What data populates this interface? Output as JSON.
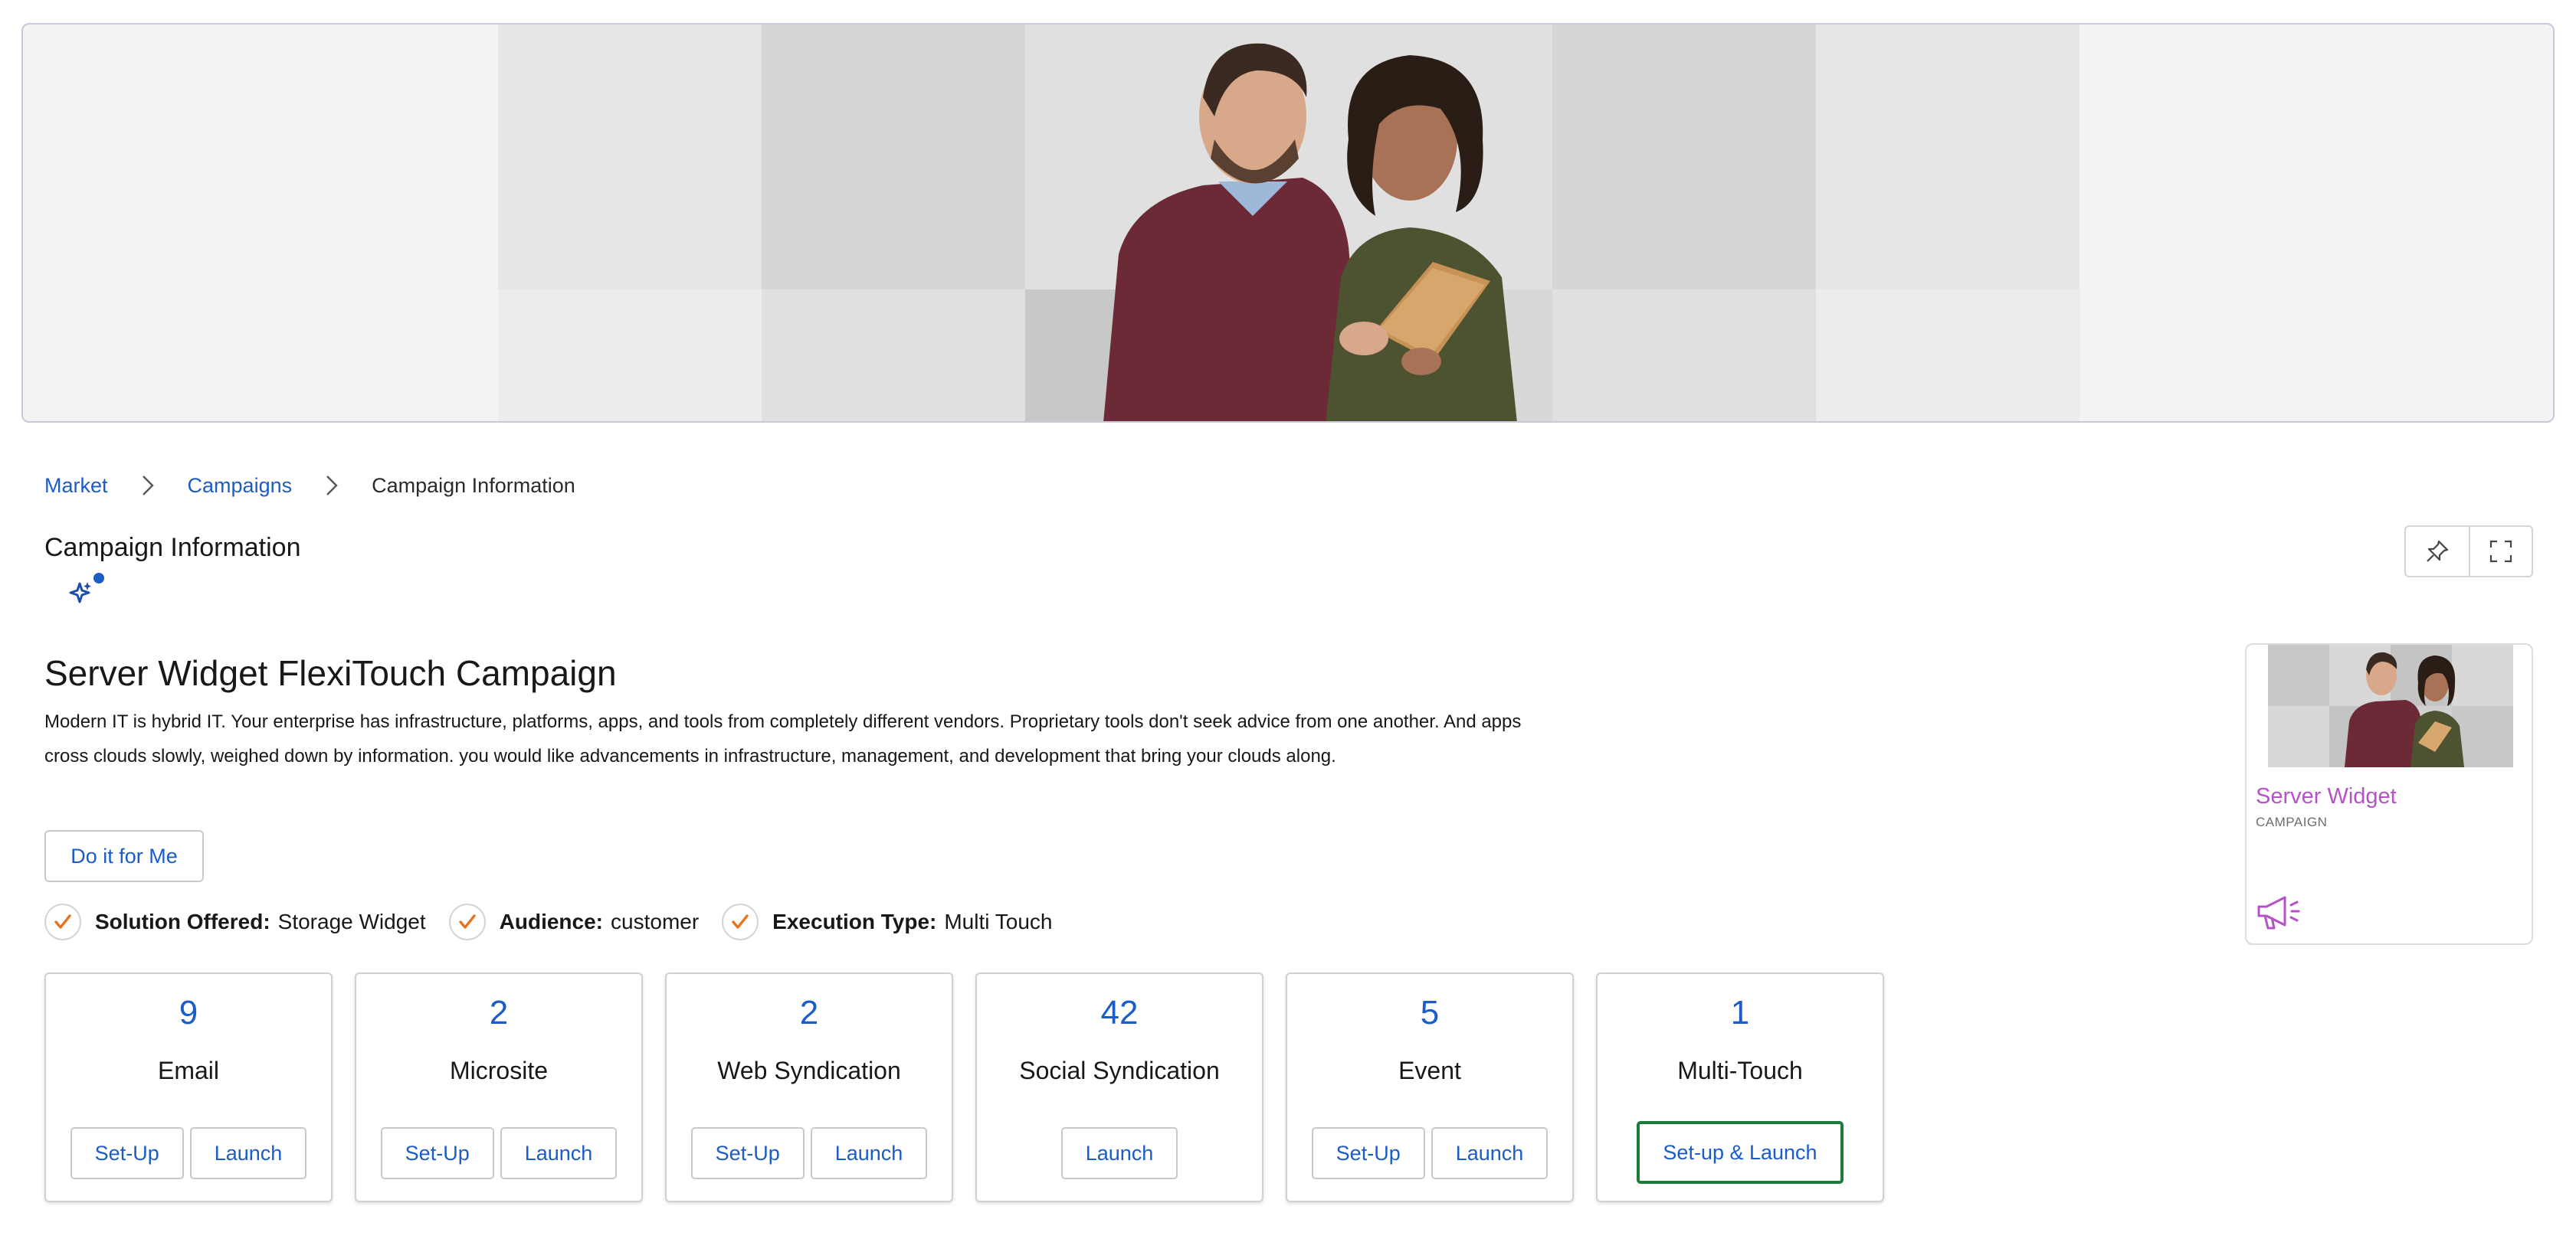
{
  "breadcrumb": {
    "items": [
      {
        "label": "Market"
      },
      {
        "label": "Campaigns"
      }
    ],
    "current": "Campaign Information"
  },
  "page": {
    "title": "Campaign Information"
  },
  "campaign": {
    "name": "Server Widget FlexiTouch Campaign",
    "description": "Modern IT is hybrid IT. Your enterprise has infrastructure, platforms, apps, and tools from completely different vendors. Proprietary tools don't seek advice from one another. And apps cross clouds slowly, weighed down by information. you would like advancements in infrastructure, management, and development that bring your clouds along.",
    "do_it_label": "Do it for Me",
    "attributes": [
      {
        "label": "Solution Offered:",
        "value": "Storage Widget"
      },
      {
        "label": "Audience:",
        "value": "customer"
      },
      {
        "label": "Execution Type:",
        "value": "Multi Touch"
      }
    ]
  },
  "tiles": [
    {
      "count": "9",
      "name": "Email",
      "actions": [
        "Set-Up",
        "Launch"
      ]
    },
    {
      "count": "2",
      "name": "Microsite",
      "actions": [
        "Set-Up",
        "Launch"
      ]
    },
    {
      "count": "2",
      "name": "Web Syndication",
      "actions": [
        "Set-Up",
        "Launch"
      ]
    },
    {
      "count": "42",
      "name": "Social Syndication",
      "actions": [
        "Launch"
      ]
    },
    {
      "count": "5",
      "name": "Event",
      "actions": [
        "Set-Up",
        "Launch"
      ]
    },
    {
      "count": "1",
      "name": "Multi-Touch",
      "actions": [
        "Set-up & Launch"
      ]
    }
  ],
  "side_card": {
    "title": "Server Widget",
    "subtitle": "CAMPAIGN",
    "icon": "megaphone-icon"
  },
  "icons": {
    "pin": "pin-icon",
    "expand": "expand-icon",
    "assist": "sparkle-icon",
    "check": "checkmark-icon",
    "chevron": "chevron-right-icon"
  },
  "colors": {
    "link": "#1b5cc8",
    "check": "#e8731f",
    "side_title": "#b452c6",
    "highlight_border": "#1e7b3a",
    "notification_dot": "#1b5cc8"
  }
}
